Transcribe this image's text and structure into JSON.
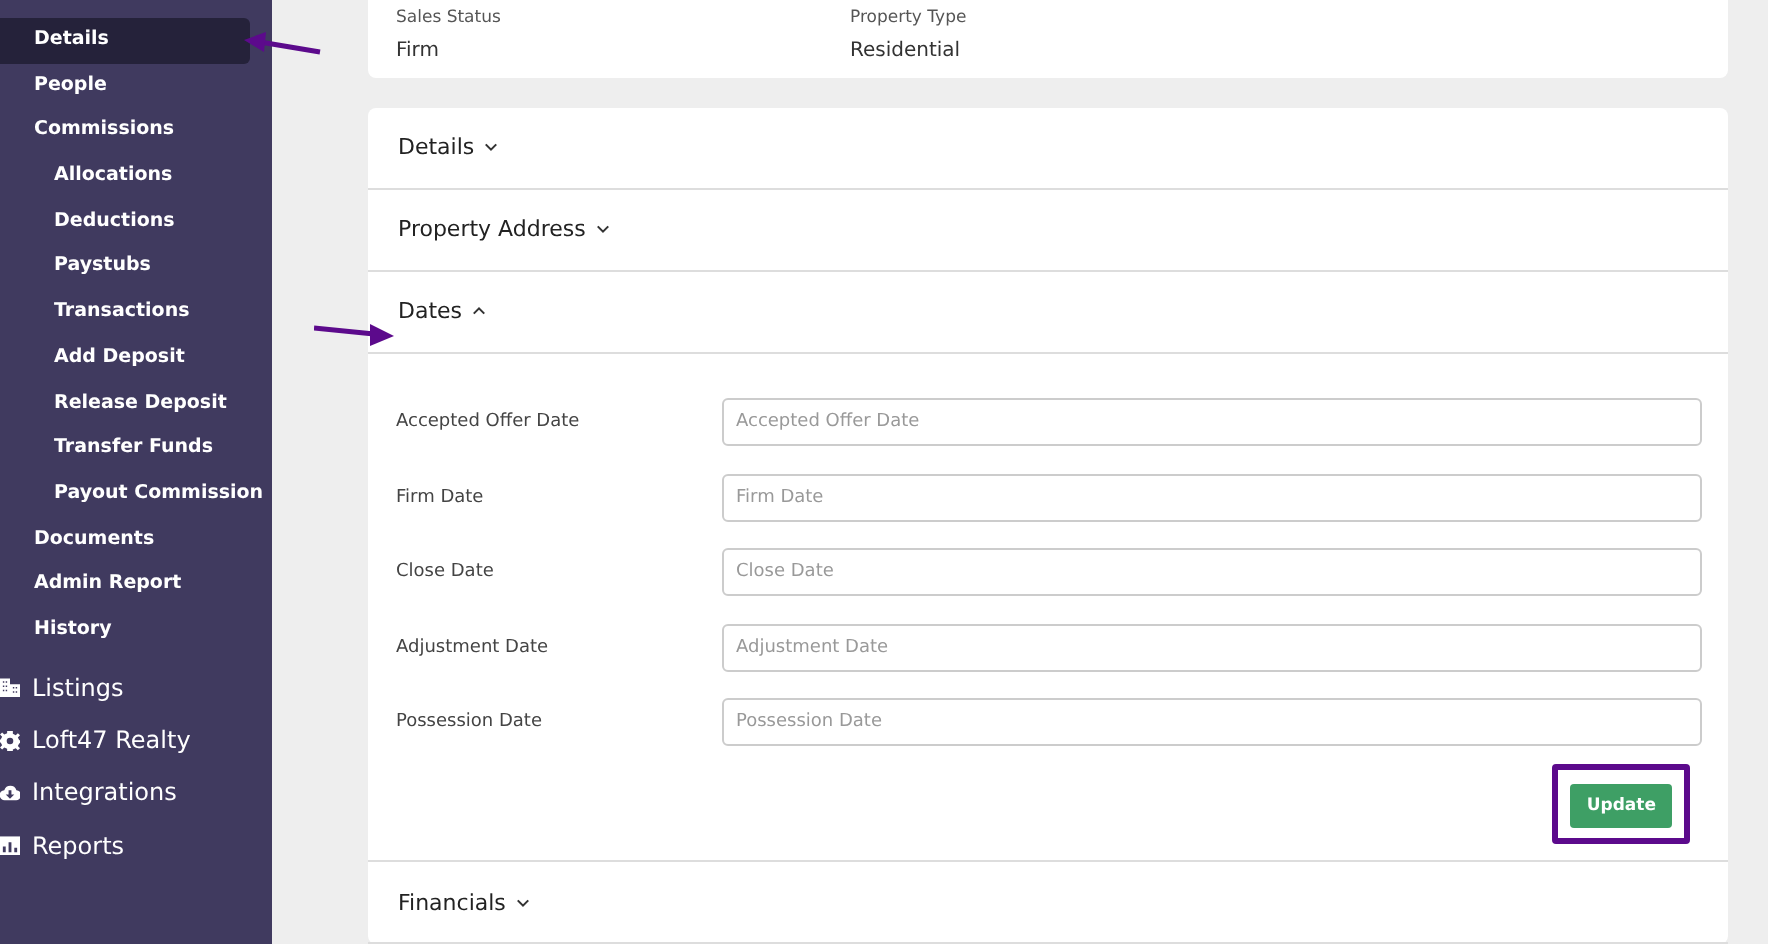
{
  "sidebar": {
    "items": [
      {
        "label": "Details",
        "selected": true
      },
      {
        "label": "People",
        "selected": false
      },
      {
        "label": "Commissions",
        "selected": false,
        "children": [
          {
            "label": "Allocations",
            "selected": false
          },
          {
            "label": "Deductions",
            "selected": false
          },
          {
            "label": "Paystubs",
            "selected": false
          },
          {
            "label": "Transactions",
            "selected": false
          },
          {
            "label": "Add Deposit",
            "selected": false
          },
          {
            "label": "Release Deposit",
            "selected": false
          },
          {
            "label": "Transfer Funds",
            "selected": false
          },
          {
            "label": "Payout Commission",
            "selected": false
          }
        ]
      },
      {
        "label": "Documents",
        "selected": false
      },
      {
        "label": "Admin Report",
        "selected": false
      },
      {
        "label": "History",
        "selected": false
      }
    ],
    "sections": [
      {
        "label": "Listings"
      },
      {
        "label": "Loft47 Realty"
      },
      {
        "label": "Integrations"
      },
      {
        "label": "Reports"
      }
    ]
  },
  "summary": [
    {
      "label": "Sales Status",
      "value": "Firm"
    },
    {
      "label": "Property Type",
      "value": "Residential"
    }
  ],
  "panels": [
    {
      "title": "Details",
      "expanded": false
    },
    {
      "title": "Property Address",
      "expanded": false
    },
    {
      "title": "Dates",
      "expanded": true,
      "fields": [
        {
          "label": "Accepted Offer Date",
          "placeholder": "Accepted Offer Date"
        },
        {
          "label": "Firm Date",
          "placeholder": "Firm Date"
        },
        {
          "label": "Close Date",
          "placeholder": "Close Date"
        },
        {
          "label": "Adjustment Date",
          "placeholder": "Adjustment Date"
        },
        {
          "label": "Possession Date",
          "placeholder": "Possession Date"
        }
      ],
      "button": "Update"
    },
    {
      "title": "Financials",
      "expanded": false
    }
  ]
}
